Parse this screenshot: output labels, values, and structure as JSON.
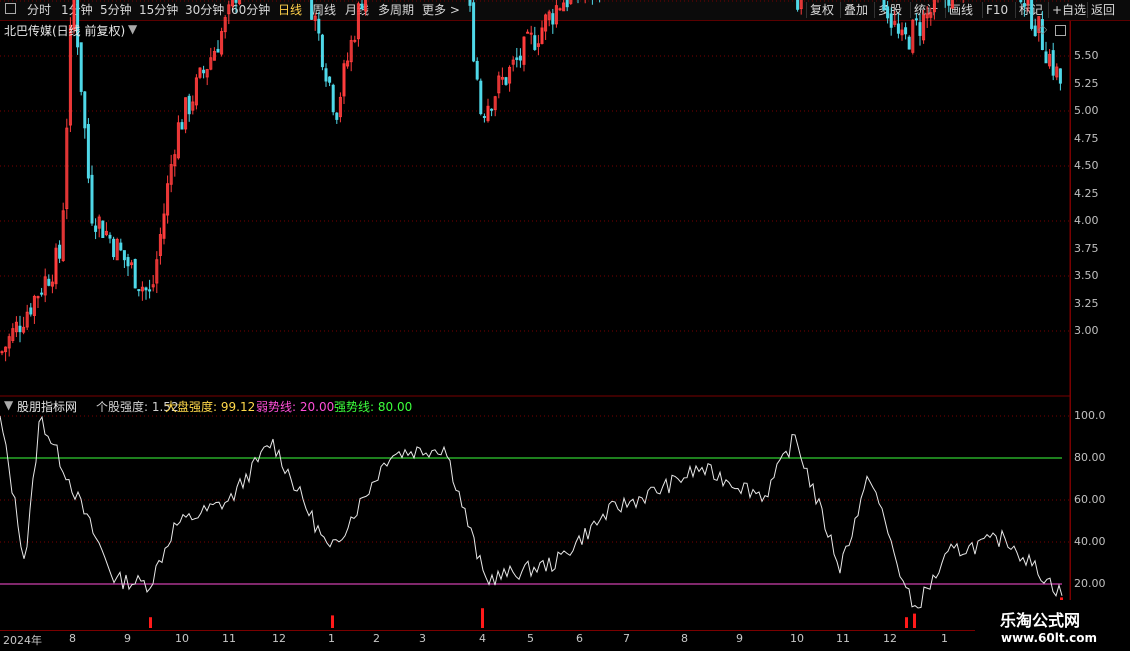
{
  "toolbar": {
    "periods": [
      "分时",
      "1分钟",
      "5分钟",
      "15分钟",
      "30分钟",
      "60分钟",
      "日线",
      "周线",
      "月线",
      "多周期",
      "更多 >"
    ],
    "active": "日线",
    "actions": [
      "复权",
      "叠加",
      "多股",
      "统计",
      "画线",
      "F10",
      "标记",
      "+自选",
      "返回"
    ]
  },
  "main": {
    "title": "北巴传媒(日线 前复权)",
    "axis": [
      "5.50",
      "5.25",
      "5.00",
      "4.75",
      "4.50",
      "4.25",
      "4.00",
      "3.75",
      "3.50",
      "3.25",
      "3.00"
    ]
  },
  "indicator": {
    "name": "股朋指标网",
    "legend": [
      {
        "label": "个股强度: ",
        "value": "1.52",
        "color": "#d0d0d0"
      },
      {
        "label": "大盘强度: ",
        "value": "99.12",
        "color": "#ffd84a"
      },
      {
        "label": "弱势线: ",
        "value": "20.00",
        "color": "#ff4fd8"
      },
      {
        "label": "强势线: ",
        "value": "80.00",
        "color": "#3cff3c"
      }
    ],
    "axis": [
      "100.0",
      "80.00",
      "60.00",
      "40.00",
      "20.00"
    ]
  },
  "dates": [
    "2024年",
    "8",
    "9",
    "10",
    "11",
    "12",
    "1",
    "2",
    "3",
    "4",
    "5",
    "6",
    "7",
    "8",
    "9",
    "10",
    "11",
    "12",
    "1"
  ],
  "watermark": {
    "line1": "乐淘公式网",
    "line2": "www.60lt.com"
  },
  "colors": {
    "up": "#ff3c3c",
    "down": "#4fd8e8",
    "strong": "#3cff3c",
    "weak": "#ff4fd8",
    "grid": "#7a0000"
  },
  "chart_data": [
    {
      "type": "candlestick",
      "title": "北巴传媒(日线 前复权)",
      "y_ticks": [
        3.0,
        3.25,
        3.5,
        3.75,
        4.0,
        4.25,
        4.5,
        4.75,
        5.0,
        5.25,
        5.5
      ],
      "close_keypoints": [
        {
          "x": "2024-07",
          "close": 2.9
        },
        {
          "x": "2024-07",
          "close": 3.35
        },
        {
          "x": "2024-08",
          "close": 4.6
        },
        {
          "x": "2024-08",
          "close": 3.55
        },
        {
          "x": "2024-09",
          "close": 3.15
        },
        {
          "x": "2024-10",
          "close": 3.9
        },
        {
          "x": "2024-11",
          "close": 4.45
        },
        {
          "x": "2024-12",
          "close": 5.25
        },
        {
          "x": "2025-01",
          "close": 4.0
        },
        {
          "x": "2025-02",
          "close": 5.1
        },
        {
          "x": "2025-03",
          "close": 5.3
        },
        {
          "x": "2025-04",
          "close": 4.0
        },
        {
          "x": "2025-05",
          "close": 4.5
        },
        {
          "x": "2025-06",
          "close": 4.6
        },
        {
          "x": "2025-07",
          "close": 4.85
        },
        {
          "x": "2025-08",
          "close": 4.7
        },
        {
          "x": "2025-09",
          "close": 5.05
        },
        {
          "x": "2025-10",
          "close": 4.5
        },
        {
          "x": "2025-11",
          "close": 5.05
        },
        {
          "x": "2025-12",
          "close": 4.3
        },
        {
          "x": "2026-01",
          "close": 4.55
        },
        {
          "x": "2026-01",
          "close": 4.72
        },
        {
          "x": "2026-01",
          "close": 4.1
        }
      ]
    },
    {
      "type": "line",
      "title": "股朋指标网",
      "y_ticks": [
        20,
        40,
        60,
        80,
        100
      ],
      "series": [
        {
          "name": "个股强度",
          "last": 1.52,
          "keypoints": [
            100,
            30,
            100,
            22,
            20,
            48,
            60,
            88,
            35,
            82,
            85,
            22,
            30,
            55,
            65,
            75,
            62,
            90,
            28,
            72,
            18,
            8,
            35,
            42,
            15
          ]
        },
        {
          "name": "弱势线",
          "values": [
            20
          ]
        },
        {
          "name": "强势线",
          "values": [
            80
          ]
        }
      ],
      "signals": [
        {
          "x": "2024-09",
          "height": 12
        },
        {
          "x": "2025-01",
          "height": 14
        },
        {
          "x": "2025-04",
          "height": 22
        },
        {
          "x": "2025-12",
          "height": 12
        },
        {
          "x": "2025-12",
          "height": 16
        },
        {
          "x": "2026-01",
          "height": 14
        },
        {
          "x": "2026-01",
          "height": 34
        }
      ]
    }
  ]
}
